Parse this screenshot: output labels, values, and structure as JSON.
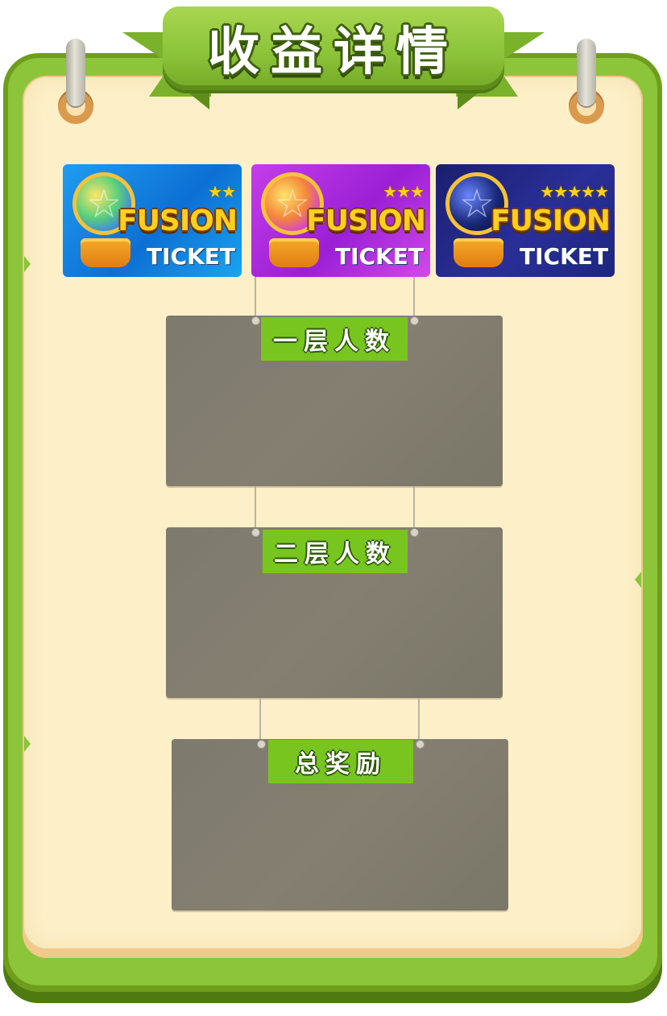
{
  "title": "收益详情",
  "tickets": [
    {
      "name": "FUSION",
      "sub": "TICKET",
      "stars": "★★"
    },
    {
      "name": "FUSION",
      "sub": "TICKET",
      "stars": "★★★"
    },
    {
      "name": "FUSION",
      "sub": "TICKET",
      "stars": "★★★★★"
    }
  ],
  "panels": {
    "layer1_label": "一层人数",
    "layer2_label": "二层人数",
    "total_label": "总奖励"
  },
  "colors": {
    "board_green": "#8cc43a",
    "paper": "#fdf0c8",
    "panel_gray": "#807c6f",
    "label_green": "#79c51f"
  }
}
